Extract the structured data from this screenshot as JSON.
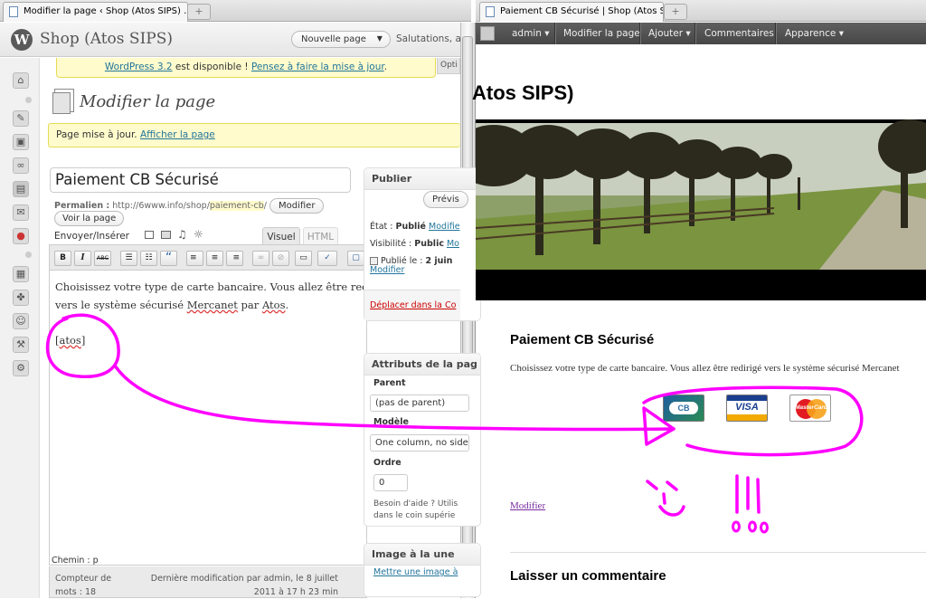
{
  "left_tab": {
    "title": "Modifier la page ‹ Shop (Atos SIPS) …",
    "new_tab": "+"
  },
  "right_tab": {
    "title": "Paiement CB Sécurisé | Shop (Atos S…",
    "new_tab": "+"
  },
  "wp": {
    "site_title": "Shop (Atos SIPS)",
    "new_page_button": "Nouvelle page",
    "greeting": "Salutations, a",
    "options_tab": "Opti",
    "update_notice": {
      "version_link": "WordPress 3.2",
      "middle": " est disponible ! ",
      "update_link": "Pensez à faire la mise à jour",
      "end": "."
    },
    "page_heading": "Modifier la page",
    "saved_notice": {
      "text": "Page mise à jour. ",
      "link": "Afficher la page"
    },
    "post_title": "Paiement CB Sécurisé",
    "permalink": {
      "label": "Permalien :",
      "base": "http://6www.info/shop/",
      "slug": "paiement-cb",
      "end": "/",
      "edit_button": "Modifier",
      "view_button": "Voir la page"
    },
    "upload_label": "Envoyer/Insérer",
    "tabs": {
      "visual": "Visuel",
      "html": "HTML"
    },
    "toolbar": {
      "bold": "B",
      "italic": "I",
      "strike": "ABC",
      "bullets": "☰",
      "numbers": "☷",
      "quote": "“",
      "align_left": "≡",
      "align_center": "≡",
      "align_right": "≡",
      "link": "∞",
      "unlink": "⊘",
      "more": "▭",
      "spell": "✓",
      "fullscreen": "▢"
    },
    "content": {
      "line1": "Choisissez votre type de carte bancaire. Vous allez être redi",
      "line2_a": "vers le système sécurisé ",
      "line2_b": "Mercanet",
      "line2_c": " par ",
      "line2_d": "Atos",
      "line2_e": ".",
      "shortcode_a": "[",
      "shortcode_b": "atos",
      "shortcode_c": "]"
    },
    "path": "Chemin : p",
    "word_count": {
      "line1": "Compteur de",
      "line2": "mots : 18"
    },
    "last_modified": {
      "line1": "Dernière modification par admin, le 8 juillet",
      "line2": "2011 à 17 h 23 min"
    },
    "publish": {
      "title": "Publier",
      "preview": "Prévis",
      "status_label": "État : ",
      "status_value": "Publié",
      "status_edit": "Modifie",
      "visibility_label": "Visibilité : ",
      "visibility_value": "Public",
      "visibility_edit": "Mo",
      "published_label": "Publié le : ",
      "published_value": "2 juin",
      "published_edit": "Modifier",
      "trash": "Déplacer dans la Co"
    },
    "attributes": {
      "title": "Attributs de la pag",
      "parent_label": "Parent",
      "parent_value": "(pas de parent)",
      "template_label": "Modèle",
      "template_value": "One column, no side",
      "order_label": "Ordre",
      "order_value": "0",
      "help1": "Besoin d'aide ? Utilis",
      "help2": "dans le coin supérie"
    },
    "featured": {
      "title": "Image à la une",
      "link": "Mettre une image à"
    }
  },
  "site": {
    "admin_bar": {
      "admin": "admin ▾",
      "edit": "Modifier la page",
      "add": "Ajouter ▾",
      "comments": "Commentaires",
      "appearance": "Apparence ▾"
    },
    "header_title": "Atos SIPS)",
    "entry_title": "Paiement CB Sécurisé",
    "entry_text": "Choisissez votre type de carte bancaire. Vous allez être redirigé vers le système sécurisé Mercanet",
    "cards": {
      "cb": "CB",
      "visa": "VISA",
      "mastercard": "MasterCard"
    },
    "edit_link": "Modifier",
    "comment_heading": "Laisser un commentaire"
  },
  "colors": {
    "annotation": "#ff00ff",
    "wp_link": "#21759b",
    "notice_bg": "#fffbcc",
    "admin_bar": "#464646",
    "site_link": "#7a2ea0"
  }
}
